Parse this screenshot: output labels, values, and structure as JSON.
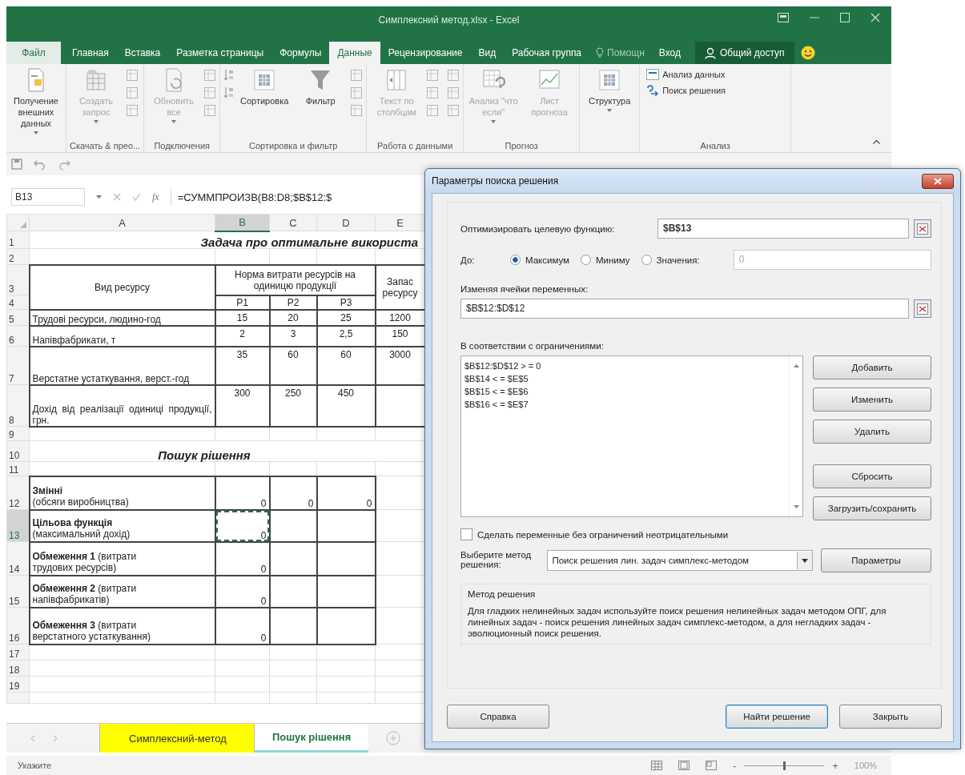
{
  "title_bar": {
    "title": "Симплексний метод.xlsx - Excel"
  },
  "ribbon_tabs": [
    {
      "label": "Файл",
      "selected": false,
      "kind": "file"
    },
    {
      "label": "Главная",
      "selected": false,
      "kind": "tab"
    },
    {
      "label": "Вставка",
      "selected": false,
      "kind": "tab"
    },
    {
      "label": "Разметка страницы",
      "selected": false,
      "kind": "tab"
    },
    {
      "label": "Формулы",
      "selected": false,
      "kind": "tab"
    },
    {
      "label": "Данные",
      "selected": true,
      "kind": "tab"
    },
    {
      "label": "Рецензирование",
      "selected": false,
      "kind": "tab"
    },
    {
      "label": "Вид",
      "selected": false,
      "kind": "tab"
    },
    {
      "label": "Рабочая группа",
      "selected": false,
      "kind": "tab"
    }
  ],
  "tell_me": "Помощн",
  "sign_in": "Вход",
  "share": "Общий доступ",
  "ribbon_groups": [
    {
      "buttons": [
        {
          "lines": [
            "Получение",
            "внешних данных"
          ],
          "dropdown": true,
          "disabled": false,
          "kind": "large"
        }
      ]
    },
    {
      "label": "Скачать & прео...",
      "buttons": [
        {
          "lines": [
            "Создать",
            "запрос"
          ],
          "dropdown": true,
          "disabled": true,
          "kind": "large"
        }
      ]
    },
    {
      "label": "Подключения",
      "buttons": [
        {
          "lines": [
            "Обновить",
            "все"
          ],
          "dropdown": true,
          "disabled": true,
          "kind": "large"
        }
      ]
    },
    {
      "label": "Сортировка и фильтр",
      "buttons": [
        {
          "lines": [
            "Сортировка"
          ],
          "dropdown": false,
          "disabled": false,
          "kind": "large"
        },
        {
          "lines": [
            "Фильтр"
          ],
          "dropdown": false,
          "disabled": false,
          "kind": "large"
        }
      ]
    },
    {
      "label": "Работа с данными",
      "buttons": [
        {
          "lines": [
            "Текст по",
            "столбцам"
          ],
          "dropdown": false,
          "disabled": true,
          "kind": "large"
        }
      ]
    },
    {
      "label": "Прогноз",
      "buttons": [
        {
          "lines": [
            "Анализ \"что",
            "если\""
          ],
          "dropdown": true,
          "disabled": true,
          "kind": "large"
        },
        {
          "lines": [
            "Лист",
            "прогноза"
          ],
          "dropdown": false,
          "disabled": true,
          "kind": "large"
        }
      ]
    },
    {
      "buttons": [
        {
          "lines": [
            "Структура"
          ],
          "dropdown": true,
          "disabled": false,
          "kind": "large"
        }
      ]
    },
    {
      "label": "Анализ",
      "buttons": [
        {
          "lines": [
            "Анализ данных"
          ],
          "dropdown": false,
          "disabled": false,
          "kind": "small"
        },
        {
          "lines": [
            "Поиск решения"
          ],
          "dropdown": false,
          "disabled": false,
          "kind": "small"
        }
      ]
    }
  ],
  "formula_bar": {
    "name_box": "B13",
    "function_label": "fx",
    "formula": "=СУММПРОИЗВ(B8:D8;$B$12:$"
  },
  "columns": [
    {
      "label": "A",
      "selected": false
    },
    {
      "label": "B",
      "selected": true
    },
    {
      "label": "C",
      "selected": false
    },
    {
      "label": "D",
      "selected": false
    },
    {
      "label": "E",
      "selected": false
    }
  ],
  "rows": [
    {
      "number": "1",
      "selected": false,
      "cells": [
        {
          "kind": "title",
          "text": "Задача про оптимальне використа",
          "colspan": 5
        }
      ]
    },
    {
      "number": "2",
      "selected": false,
      "cells": []
    },
    {
      "number": "3",
      "selected": false,
      "cells": [
        {
          "kind": "center",
          "text": "Вид ресурсу",
          "rowspan": 2,
          "boxed": true
        },
        {
          "kind": "center",
          "text": "Норма витрати ресурсів на одиницю продукції",
          "colspan": 3,
          "boxed": true
        },
        {
          "kind": "center",
          "text": "Запас ресурсу",
          "rowspan": 2,
          "boxed": true
        }
      ]
    },
    {
      "number": "4",
      "selected": false,
      "cells": [
        {
          "kind": "center",
          "text": "P1",
          "boxed": true
        },
        {
          "kind": "center",
          "text": "P2",
          "boxed": true
        },
        {
          "kind": "center",
          "text": "P3",
          "boxed": true
        }
      ]
    },
    {
      "number": "5",
      "selected": false,
      "cells": [
        {
          "kind": "text",
          "text": "Трудові ресурси, людино-год",
          "boxed": true
        },
        {
          "kind": "value",
          "text": "15",
          "boxed": true
        },
        {
          "kind": "value",
          "text": "20",
          "boxed": true
        },
        {
          "kind": "value",
          "text": "25",
          "boxed": true
        },
        {
          "kind": "value",
          "text": "1200",
          "boxed": true
        }
      ]
    },
    {
      "number": "6",
      "selected": false,
      "cells": [
        {
          "kind": "text",
          "text": "Напівфабрикати, т",
          "boxed": true
        },
        {
          "kind": "value",
          "text": "2",
          "boxed": true
        },
        {
          "kind": "value",
          "text": "3",
          "boxed": true
        },
        {
          "kind": "value",
          "text": "2,5",
          "boxed": true
        },
        {
          "kind": "value",
          "text": "150",
          "boxed": true
        }
      ]
    },
    {
      "number": "7",
      "selected": false,
      "cells": [
        {
          "kind": "text",
          "text": "Верстатне устаткування, верст.-год",
          "boxed": true
        },
        {
          "kind": "value",
          "text": "35",
          "boxed": true
        },
        {
          "kind": "value",
          "text": "60",
          "boxed": true
        },
        {
          "kind": "value",
          "text": "60",
          "boxed": true
        },
        {
          "kind": "value",
          "text": "3000",
          "boxed": true
        }
      ]
    },
    {
      "number": "8",
      "selected": false,
      "cells": [
        {
          "kind": "justify",
          "text": "Дохід від реалізації одиниці продукції, грн.",
          "boxed": true
        },
        {
          "kind": "value",
          "text": "300",
          "boxed": true
        },
        {
          "kind": "value",
          "text": "250",
          "boxed": true
        },
        {
          "kind": "value",
          "text": "450",
          "boxed": true
        },
        {
          "kind": "blank",
          "boxed": true
        }
      ]
    },
    {
      "number": "9",
      "selected": false,
      "cells": []
    },
    {
      "number": "10",
      "selected": false,
      "cells": [
        {
          "kind": "heading",
          "text": "Пошук рішення",
          "colspan": 5
        }
      ]
    },
    {
      "number": "11",
      "selected": false,
      "cells": []
    },
    {
      "number": "12",
      "selected": false,
      "cells": [
        {
          "kind": "label",
          "lines": [
            "**Змінні**",
            "(обсяги виробництва)"
          ],
          "boxed": true
        },
        {
          "kind": "number",
          "text": "0",
          "boxed": true
        },
        {
          "kind": "number",
          "text": "0",
          "boxed": true
        },
        {
          "kind": "number",
          "text": "0",
          "boxed": true
        },
        {
          "kind": "blank"
        }
      ]
    },
    {
      "number": "13",
      "selected": true,
      "cells": [
        {
          "kind": "label",
          "lines": [
            "**Цільова функція**",
            "(максимальний дохід)"
          ],
          "boxed": true
        },
        {
          "kind": "number",
          "text": "0",
          "boxed": true,
          "marquee": true
        },
        {
          "kind": "blank",
          "boxed": true
        },
        {
          "kind": "blank",
          "boxed": true
        },
        {
          "kind": "blank"
        }
      ]
    },
    {
      "number": "14",
      "selected": false,
      "cells": [
        {
          "kind": "label",
          "lines": [
            "**Обмеження 1** (витрати",
            "трудових ресурсів)"
          ],
          "boxed": true
        },
        {
          "kind": "number",
          "text": "0",
          "boxed": true
        },
        {
          "kind": "blank",
          "boxed": true
        },
        {
          "kind": "blank",
          "boxed": true
        },
        {
          "kind": "blank"
        }
      ]
    },
    {
      "number": "15",
      "selected": false,
      "cells": [
        {
          "kind": "label",
          "lines": [
            "**Обмеження 2** (витрати",
            "напівфабрикатів)"
          ],
          "boxed": true
        },
        {
          "kind": "number",
          "text": "0",
          "boxed": true
        },
        {
          "kind": "blank",
          "boxed": true
        },
        {
          "kind": "blank",
          "boxed": true
        },
        {
          "kind": "blank"
        }
      ]
    },
    {
      "number": "16",
      "selected": false,
      "cells": [
        {
          "kind": "label",
          "lines": [
            "**Обмеження 3** (витрати",
            "верстатного устаткування)"
          ],
          "boxed": true
        },
        {
          "kind": "number",
          "text": "0",
          "boxed": true
        },
        {
          "kind": "blank",
          "boxed": true
        },
        {
          "kind": "blank",
          "boxed": true
        },
        {
          "kind": "blank"
        }
      ]
    },
    {
      "number": "17",
      "selected": false,
      "cells": []
    },
    {
      "number": "18",
      "selected": false,
      "cells": []
    },
    {
      "number": "19",
      "selected": false,
      "cells": []
    }
  ],
  "sheet_tabs": [
    {
      "label": "Симплексний-метод",
      "selected": false,
      "color": "#ffff00"
    },
    {
      "label": "Пошук рішення",
      "selected": true,
      "color": "#8fd3d8"
    }
  ],
  "status_bar": {
    "text": "Укажите",
    "zoom_out": "-",
    "zoom_in": "+",
    "zoom": {
      "level": 0.5
    },
    "zoom_label": "100%"
  },
  "dialog": {
    "title": "Параметры поиска решения",
    "objective": {
      "label": "Оптимизировать целевую функцию:",
      "value": "$B$13"
    },
    "to": {
      "label": "До:",
      "options": [
        {
          "label": "Максимум",
          "selected": true
        },
        {
          "label": "Миниму",
          "selected": false
        },
        {
          "label": "Значения:",
          "selected": false
        }
      ],
      "value": "0",
      "value_disabled": true
    },
    "variables": {
      "label": "Изменяя ячейки переменных:",
      "value": "$B$12:$D$12"
    },
    "constraints": {
      "label": "В соответствии с ограничениями:",
      "items": [
        "$B$12:$D$12 > = 0",
        "$B$14 < = $E$5",
        "$B$15 < = $E$6",
        "$B$16 < = $E$7"
      ]
    },
    "constraint_buttons": [
      "Добавить",
      "Изменить",
      "Удалить",
      "Сбросить",
      "Загрузить/сохранить"
    ],
    "nonnegative": {
      "label": "Сделать переменные без ограничений неотрицательными",
      "checked": false
    },
    "method": {
      "label": "Выберите метод решения:",
      "value": "Поиск решения лин. задач симплекс-методом",
      "button": "Параметры"
    },
    "description": {
      "title": "Метод решения",
      "text": "Для гладких нелинейных задач используйте поиск решения нелинейных задач методом ОПГ, для линейных задач - поиск решения линейных задач симплекс-методом, а для негладких задач - эволюционный поиск решения."
    },
    "footer_buttons": [
      {
        "label": "Справка",
        "default": false
      },
      {
        "label": "Найти решение",
        "default": true
      },
      {
        "label": "Закрыть",
        "default": false
      }
    ]
  }
}
